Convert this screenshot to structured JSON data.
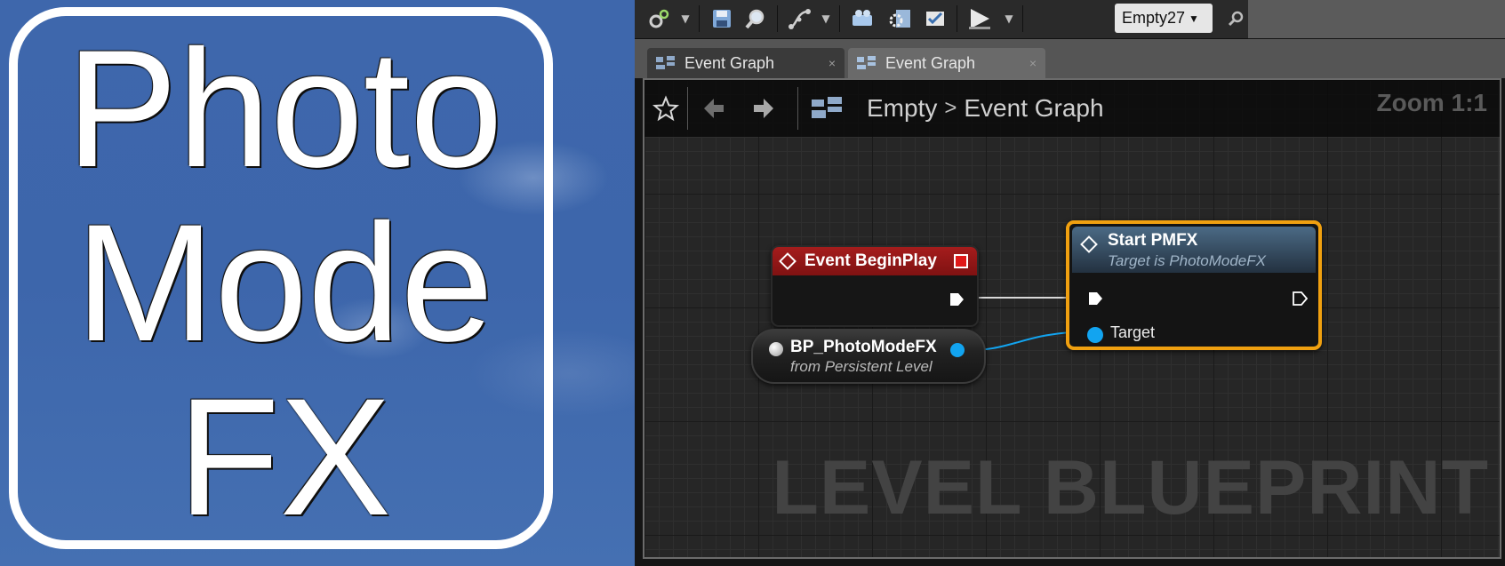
{
  "logo": {
    "line1": "Photo",
    "line2": "Mode",
    "line3": "FX"
  },
  "toolbar": {
    "level_dropdown_value": "Empty27"
  },
  "tabs": [
    {
      "label": "Event Graph",
      "close": "×"
    },
    {
      "label": "Event Graph",
      "close": "×"
    }
  ],
  "graph": {
    "breadcrumb": {
      "root": "Empty",
      "separator": ">",
      "current": "Event Graph"
    },
    "zoom": "Zoom 1:1",
    "watermark": "LEVEL BLUEPRINT",
    "nodes": {
      "begin_play": {
        "title": "Event BeginPlay"
      },
      "variable": {
        "name": "BP_PhotoModeFX",
        "subtitle": "from Persistent Level"
      },
      "start_pmfx": {
        "title": "Start PMFX",
        "subtitle": "Target is PhotoModeFX",
        "target_pin_label": "Target"
      }
    }
  },
  "colors": {
    "logo_background": "#3e67ac",
    "event_node_header": "#a51c1c",
    "function_node_header": "#4b6a85",
    "selection_outline": "#f0a010",
    "object_pin": "#12a4f0"
  }
}
